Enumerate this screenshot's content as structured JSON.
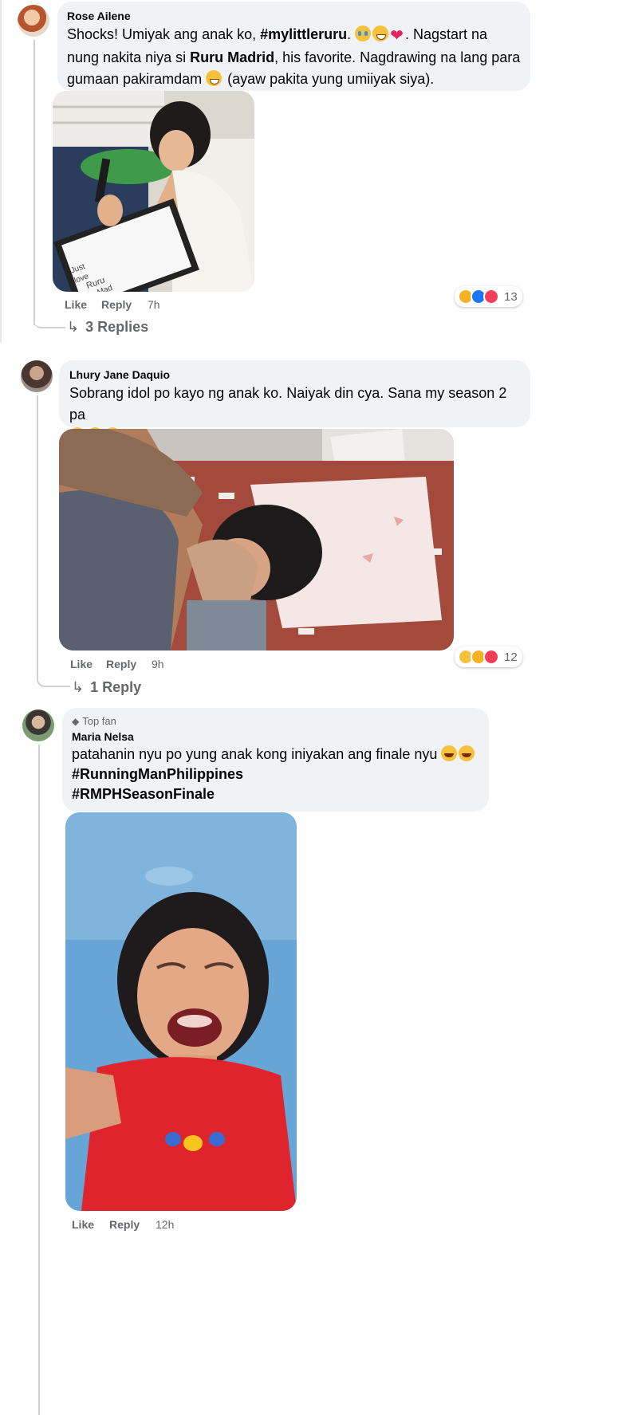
{
  "comments": [
    {
      "author": "Rose Ailene",
      "text_parts": [
        "Shocks! Umiyak ang anak ko, ",
        "#mylittleruru",
        ". ",
        ". Nagstart na nung nakita niya si ",
        "Ruru Madrid",
        ", his favorite. Nagdrawing na lang para gumaan pakiramdam ",
        " (ayaw pakita yung umiiyak siya)."
      ],
      "like": "Like",
      "reply": "Reply",
      "time": "7h",
      "reaction_count": "13",
      "replies": "3 Replies"
    },
    {
      "author": "Lhury Jane Daquio",
      "text": "Sobrang idol po kayo ng anak ko. Naiyak din cya. Sana my season 2 pa",
      "like": "Like",
      "reply": "Reply",
      "time": "9h",
      "reaction_count": "12",
      "replies": "1 Reply"
    },
    {
      "badge": "Top fan",
      "author": "Maria Nelsa",
      "text": "patahanin nyu po yung anak kong iniyakan ang finale nyu",
      "hashtag1": "#RunningManPhilippines",
      "hashtag2": "#RMPHSeasonFinale",
      "like": "Like",
      "reply": "Reply",
      "time": "12h"
    }
  ],
  "drawing_text": [
    "Just",
    "love",
    "Ruru",
    "Mad"
  ],
  "colors": {
    "bubble": "#f0f2f5",
    "secondary_text": "#65676b",
    "like_blue": "#1877f2",
    "love_red": "#f33e58",
    "care_yellow": "#f7b125"
  }
}
